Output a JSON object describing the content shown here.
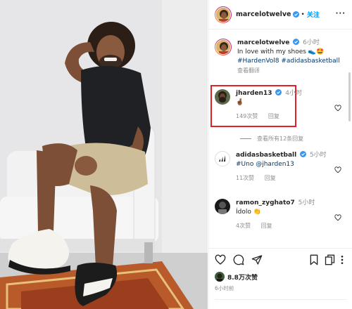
{
  "post": {
    "username": "marcelotwelve",
    "follow_label": "关注",
    "more_label": "···",
    "caption": {
      "username": "marcelotwelve",
      "time": "6小时",
      "text": "In love with my shoes 👟🤩",
      "hashtags": "#HardenVol8 #adidasbasketball",
      "translate_label": "查看翻译"
    },
    "comments": [
      {
        "username": "jharden13",
        "time": "4小时",
        "text": "🤞🏾",
        "likes": "149次赞",
        "reply_label": "回复",
        "highlighted": true
      },
      {
        "username": "adidasbasketball",
        "time": "5小时",
        "text_tag1": "#Uno",
        "text_tag2": "@jharden13",
        "likes": "11次赞",
        "reply_label": "回复"
      },
      {
        "username": "ramon_zyghato7",
        "time": "5小时",
        "text": "Ídolo 👏",
        "likes": "4次赞",
        "reply_label": "回复"
      }
    ],
    "view_replies_label": "查看所有12条回复",
    "like_count": "8.8万次赞",
    "posted_time": "6小时前"
  },
  "colors": {
    "accent": "#0095f6",
    "verified": "#3897f0",
    "highlight_box": "#e0202a",
    "muted_text": "#8e8e8e"
  },
  "icons": [
    "heart-icon",
    "comment-icon",
    "share-icon",
    "bookmark-icon",
    "copy-icon",
    "more-vert-icon"
  ]
}
